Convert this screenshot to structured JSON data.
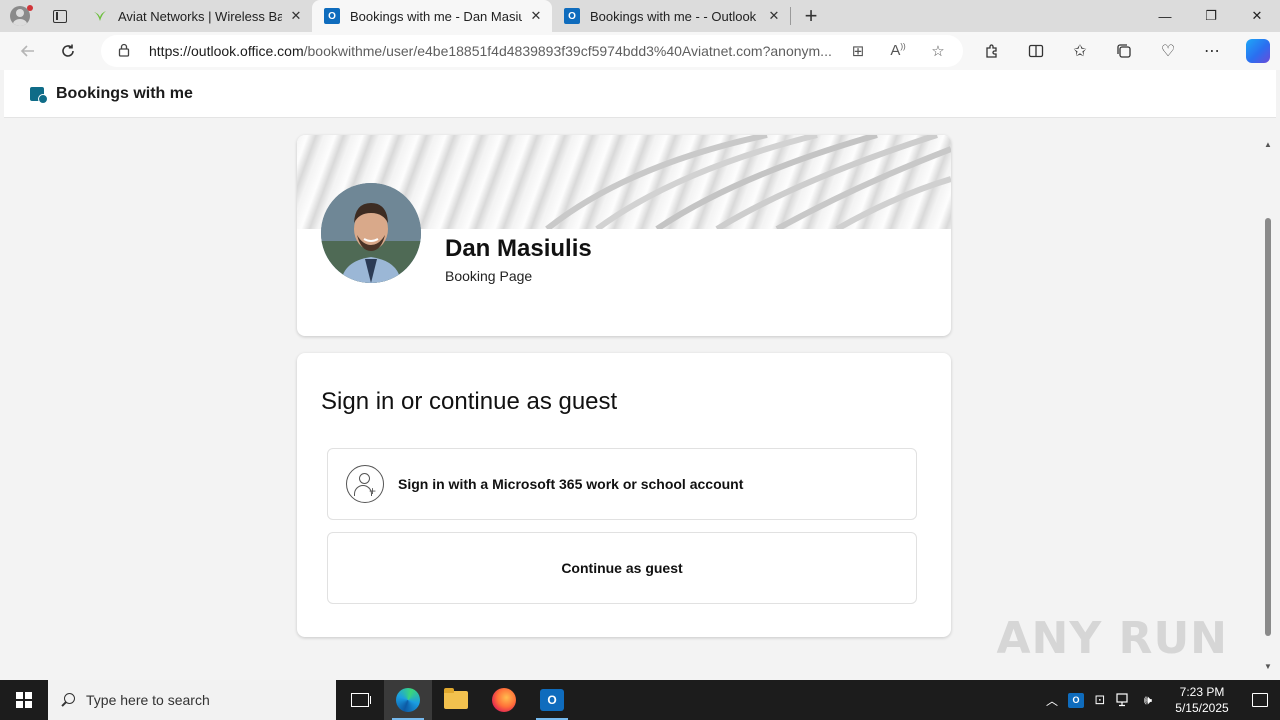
{
  "browser": {
    "tabs": [
      {
        "title": "Aviat Networks | Wireless Backha",
        "active": false,
        "favicon": "aviat-leaf-icon"
      },
      {
        "title": "Bookings with me - Dan Masiulis",
        "active": true,
        "favicon": "outlook-icon"
      },
      {
        "title": "Bookings with me - - Outlook",
        "active": false,
        "favicon": "outlook-icon"
      }
    ],
    "new_tab_label": "+",
    "address": {
      "host": "https://outlook.office.com",
      "path": "/bookwithme/user/e4be18851f4d4839893f39cf5974bdd3%40Aviatnet.com?anonym..."
    }
  },
  "app": {
    "title": "Bookings with me"
  },
  "profile": {
    "name": "Dan Masiulis",
    "subtitle": "Booking Page"
  },
  "signin": {
    "heading": "Sign in or continue as guest",
    "options": [
      {
        "label": "Sign in with a Microsoft 365 work or school account",
        "icon": "person-add-icon"
      },
      {
        "label": "Continue as guest"
      }
    ]
  },
  "watermark": "ANY RUN",
  "taskbar": {
    "search_placeholder": "Type here to search",
    "time": "7:23 PM",
    "date": "5/15/2025"
  },
  "colors": {
    "accent": "#0f6cbd",
    "bookings_brand": "#0f6c88",
    "taskbar": "#1c1c1c"
  }
}
